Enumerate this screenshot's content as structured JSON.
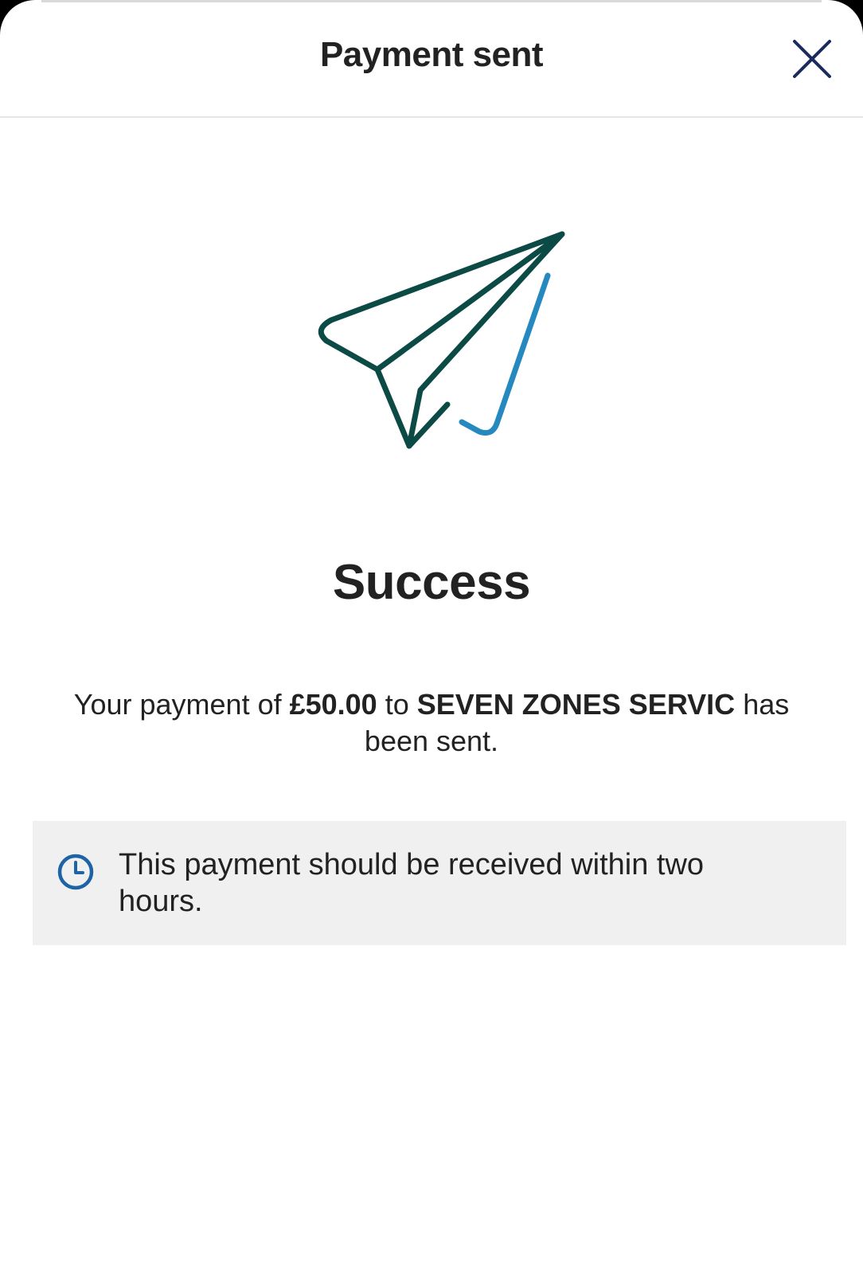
{
  "header": {
    "title": "Payment sent",
    "close_icon": "close-icon"
  },
  "illustration": {
    "icon": "paper-plane-icon",
    "primary_color": "#0c4a45",
    "accent_color": "#2589c0"
  },
  "result": {
    "title": "Success",
    "message_prefix": "Your payment of ",
    "amount": "£50.00",
    "message_mid": " to ",
    "payee": "SEVEN ZONES SERVIC",
    "message_suffix": " has been sent."
  },
  "info": {
    "icon": "clock-icon",
    "icon_color": "#1d63a5",
    "text": "This payment should be received within two hours."
  }
}
